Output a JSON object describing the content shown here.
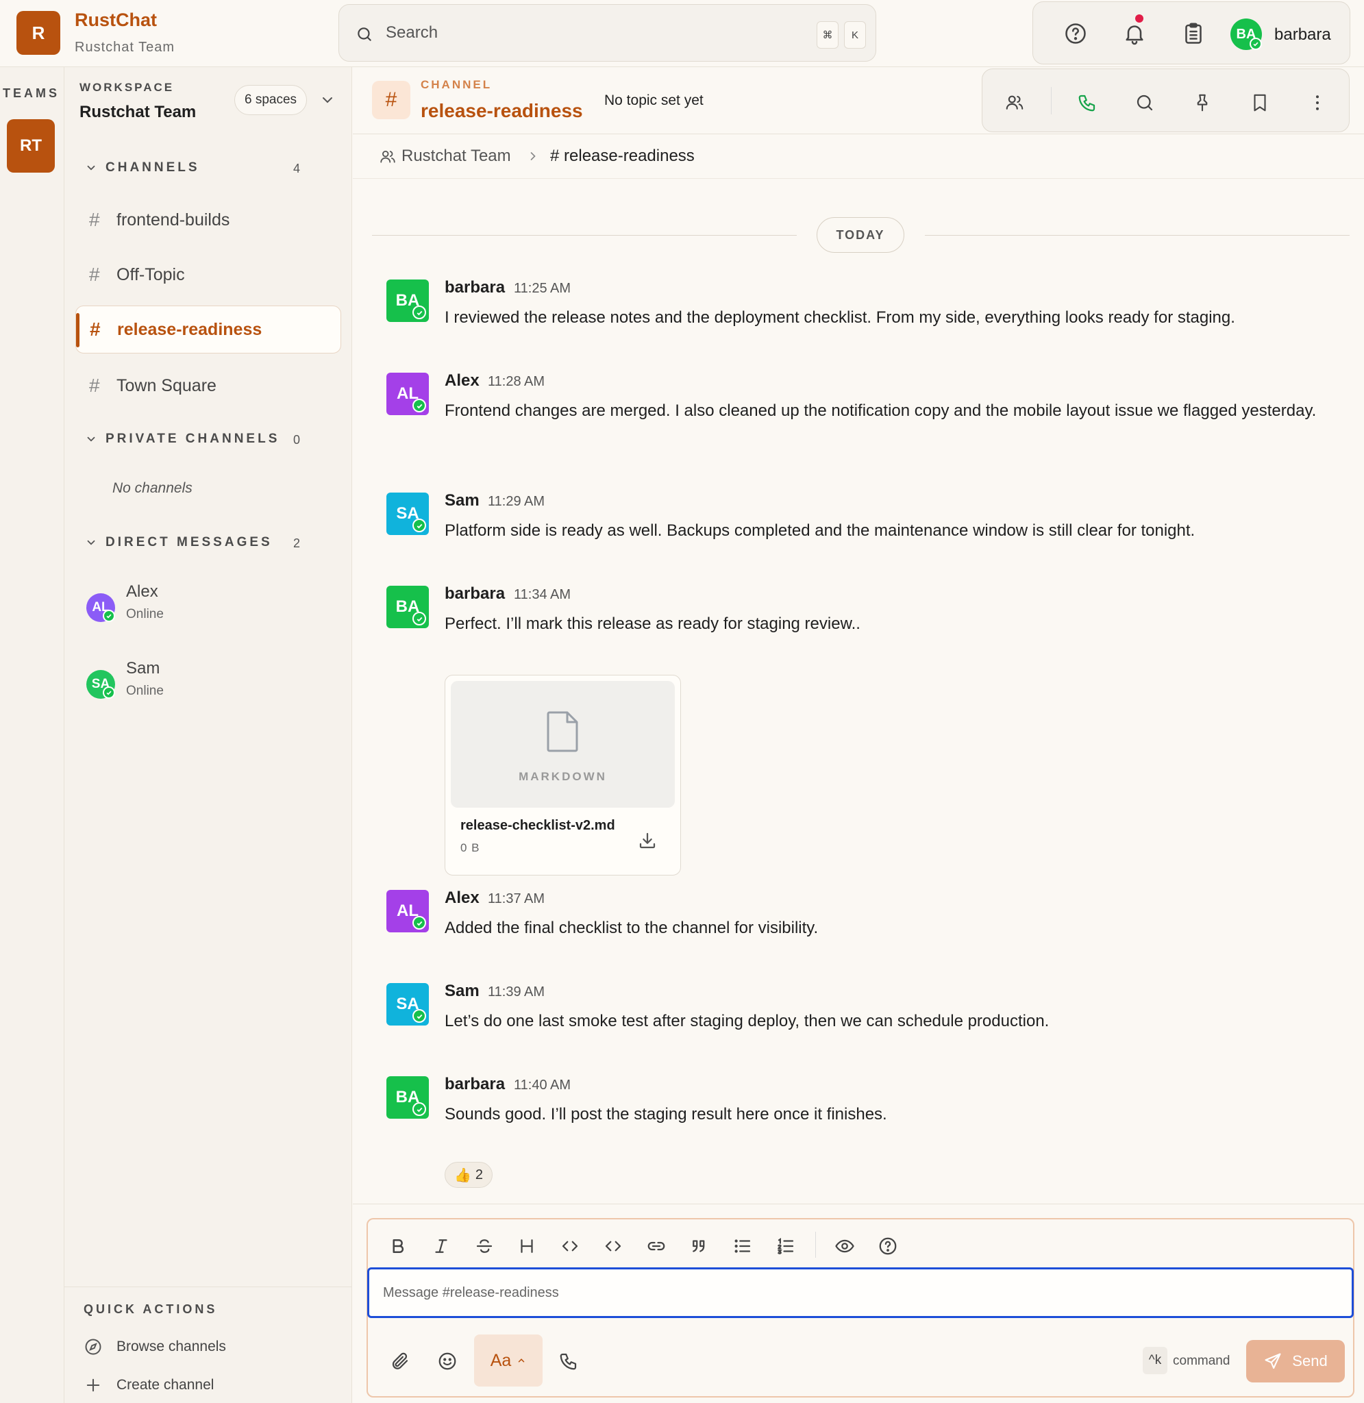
{
  "app": {
    "logo_letter": "R",
    "name": "RustChat",
    "team": "Rustchat Team"
  },
  "search": {
    "placeholder": "Search",
    "shortcut_mod": "⌘",
    "shortcut_key": "K"
  },
  "user": {
    "initials": "BA",
    "name": "barbara"
  },
  "teams": {
    "label": "TEAMS",
    "items": [
      {
        "initials": "RT"
      }
    ]
  },
  "workspace": {
    "label": "WORKSPACE",
    "name": "Rustchat Team",
    "spaces": "6 spaces"
  },
  "sidebar": {
    "channels": {
      "title": "CHANNELS",
      "count": "4",
      "items": [
        {
          "hash": "#",
          "label": "frontend-builds"
        },
        {
          "hash": "#",
          "label": "Off-Topic"
        },
        {
          "hash": "#",
          "label": "release-readiness"
        },
        {
          "hash": "#",
          "label": "Town Square"
        }
      ]
    },
    "private_channels": {
      "title": "PRIVATE CHANNELS",
      "count": "0",
      "empty": "No channels"
    },
    "direct_messages": {
      "title": "DIRECT MESSAGES",
      "count": "2",
      "items": [
        {
          "initials": "AL",
          "name": "Alex",
          "status": "Online"
        },
        {
          "initials": "SA",
          "name": "Sam",
          "status": "Online"
        }
      ]
    },
    "quick_actions": {
      "title": "QUICK ACTIONS",
      "browse": "Browse channels",
      "create": "Create channel"
    }
  },
  "channel": {
    "hash": "#",
    "kicker": "CHANNEL",
    "name": "release-readiness",
    "topic": "No topic set yet"
  },
  "breadcrumb": {
    "team": "Rustchat Team",
    "channel": "# release-readiness"
  },
  "messages": {
    "date_divider": "TODAY",
    "items": [
      {
        "initials": "BA",
        "author": "barbara",
        "time": "11:25 AM",
        "text": "I reviewed the release notes and the deployment checklist. From my side, everything looks ready for staging."
      },
      {
        "initials": "AL",
        "author": "Alex",
        "time": "11:28 AM",
        "text": "Frontend changes are merged. I also cleaned up the notification copy and the mobile layout issue we flagged yesterday."
      },
      {
        "initials": "SA",
        "author": "Sam",
        "time": "11:29 AM",
        "text": "Platform side is ready as well. Backups completed and the maintenance window is still clear for tonight."
      },
      {
        "initials": "BA",
        "author": "barbara",
        "time": "11:34 AM",
        "text": "Perfect. I’ll mark this release as ready for staging review.."
      },
      {
        "initials": "AL",
        "author": "Alex",
        "time": "11:37 AM",
        "text": "Added the final checklist to the channel for visibility."
      },
      {
        "initials": "SA",
        "author": "Sam",
        "time": "11:39 AM",
        "text": "Let’s do one last smoke test after staging deploy, then we can schedule production."
      },
      {
        "initials": "BA",
        "author": "barbara",
        "time": "11:40 AM",
        "text": "Sounds good. I’ll post the staging result here once it finishes."
      }
    ],
    "attachment": {
      "type": "MARKDOWN",
      "name": "release-checklist-v2.md",
      "size": "0 B"
    },
    "reaction": {
      "emoji": "👍",
      "count": "2"
    }
  },
  "composer": {
    "placeholder": "Message #release-readiness",
    "text_style": "Aa",
    "command_key": "^k",
    "command_label": "command",
    "send_label": "Send"
  },
  "colors": {
    "accent": "#b8520f",
    "avatar_barbara": "#16c04b",
    "avatar_alex": "#a440e8",
    "avatar_sam": "#10b3dc",
    "online": "#16c04b",
    "input_focus": "#1d4ed8"
  }
}
